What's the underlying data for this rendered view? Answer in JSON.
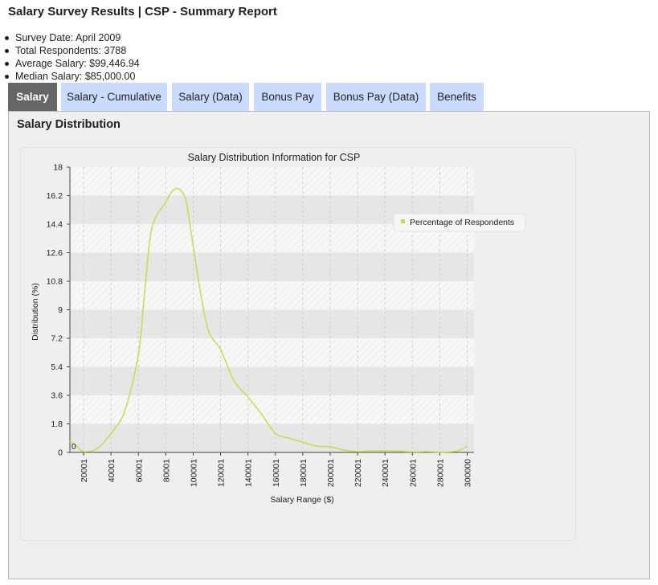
{
  "page": {
    "title": "Salary Survey Results | CSP - Summary Report"
  },
  "summary": [
    "Survey Date: April 2009",
    "Total Respondents: 3788",
    "Average Salary: $99,446.94",
    "Median Salary: $85,000.00"
  ],
  "tabs": [
    {
      "label": "Salary",
      "active": true
    },
    {
      "label": "Salary - Cumulative",
      "active": false
    },
    {
      "label": "Salary (Data)",
      "active": false
    },
    {
      "label": "Bonus Pay",
      "active": false
    },
    {
      "label": "Bonus Pay (Data)",
      "active": false
    },
    {
      "label": "Benefits",
      "active": false
    }
  ],
  "section": {
    "title": "Salary Distribution"
  },
  "colors": {
    "series": "#c4dd4a",
    "tab_active": "#666666",
    "tab_inactive": "#c9dcff",
    "band_dark": "#e6e6e6",
    "band_light": "#f6f6f6"
  },
  "chart_data": {
    "type": "line",
    "title": "Salary Distribution Information for CSP",
    "xlabel": "Salary Range ($)",
    "ylabel": "Distribution (%)",
    "x_ticks": [
      "20001",
      "40001",
      "60001",
      "80001",
      "100001",
      "120001",
      "140001",
      "160001",
      "180001",
      "200001",
      "220001",
      "240001",
      "260001",
      "280001",
      "300000"
    ],
    "y_ticks": [
      "0",
      "1.8",
      "3.6",
      "5.4",
      "7.2",
      "9",
      "10.8",
      "12.6",
      "14.4",
      "16.2",
      "18"
    ],
    "ylim": [
      0,
      18
    ],
    "xlim": [
      10001,
      305000
    ],
    "grid": true,
    "legend_position": "right",
    "annotations": [
      "0"
    ],
    "series": [
      {
        "name": "Percentage of Respondents",
        "x": [
          10001,
          15001,
          20001,
          30001,
          40001,
          50001,
          60001,
          65001,
          70001,
          80001,
          85001,
          90001,
          95001,
          100001,
          110001,
          120001,
          130001,
          140001,
          150001,
          160001,
          170001,
          180001,
          190001,
          200001,
          210001,
          220001,
          230001,
          240001,
          250001,
          260001,
          270001,
          280001,
          290001,
          295001,
          300000
        ],
        "values": [
          0.7,
          0.4,
          0.05,
          0.25,
          1.2,
          2.6,
          6.2,
          10.5,
          14.2,
          15.8,
          16.5,
          16.6,
          15.8,
          13.0,
          8.0,
          6.5,
          4.5,
          3.5,
          2.4,
          1.2,
          0.9,
          0.65,
          0.4,
          0.35,
          0.15,
          0.05,
          0.1,
          0.1,
          0.08,
          0.03,
          0.05,
          0.02,
          0.05,
          0.15,
          0.4
        ]
      }
    ]
  }
}
